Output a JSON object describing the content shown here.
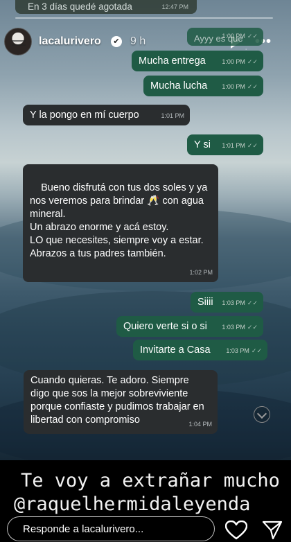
{
  "story": {
    "top_snippet": "En 3 días quedé agotada",
    "top_snippet_time": "12:47 PM",
    "username": "lacalurivero",
    "verified_mark": "✔",
    "age": "9 h",
    "more_label": "•••"
  },
  "chat": {
    "messages": [
      {
        "dir": "out",
        "text": "Ayyy es que sos muy genia",
        "time": "1:00 PM",
        "ticks": "✓✓"
      },
      {
        "dir": "out",
        "text": "Mucha entrega",
        "time": "1:00 PM",
        "ticks": "✓✓"
      },
      {
        "dir": "out",
        "text": "Mucha lucha",
        "time": "1:00 PM",
        "ticks": "✓✓"
      },
      {
        "dir": "in",
        "text": "Y la pongo en mí cuerpo",
        "time": "1:01 PM"
      },
      {
        "dir": "out",
        "text": "Y si",
        "time": "1:01 PM",
        "ticks": "✓✓"
      },
      {
        "dir": "in",
        "text": "Bueno disfrutá con tus dos soles y ya nos veremos para brindar 🥂 con agua mineral.\nUn abrazo enorme y acá estoy.\nLO que necesites, siempre voy a estar.\nAbrazos a tus padres también.",
        "time": "1:02 PM"
      },
      {
        "dir": "out",
        "text": "Siiii",
        "time": "1:03 PM",
        "ticks": "✓✓"
      },
      {
        "dir": "out",
        "text": "Quiero verte si o si",
        "time": "1:03 PM",
        "ticks": "✓✓"
      },
      {
        "dir": "out",
        "text": "Invitarte a Casa",
        "time": "1:03 PM",
        "ticks": "✓✓"
      },
      {
        "dir": "in",
        "text": "Cuando quieras. Te adoro. Siempre digo que sos la mejor sobreviviente porque confiaste y pudimos trabajar en libertad con compromiso",
        "time": "1:04 PM"
      }
    ]
  },
  "caption": {
    "line1": "Te voy a extrañar mucho",
    "line2": "@raquelhermidaleyenda"
  },
  "reply": {
    "placeholder": "Responde a lacalurivero..."
  },
  "icons": {
    "heart": "heart-icon",
    "send": "send-icon",
    "play": "play-icon",
    "scroll_down": "chevron-down-icon"
  },
  "colors": {
    "outgoing_bubble": "#1f5b45",
    "incoming_bubble": "#2a2d2f"
  }
}
